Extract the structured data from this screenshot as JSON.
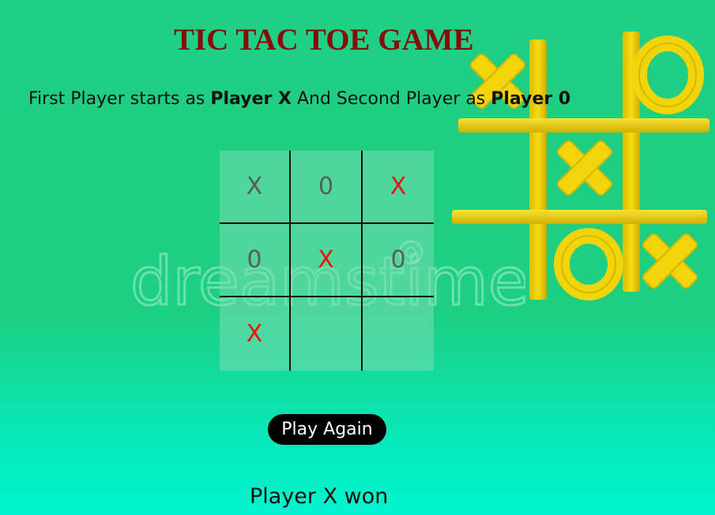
{
  "game": {
    "title": "TIC TAC TOE GAME",
    "intro": {
      "text1": "First Player starts as ",
      "player1": "Player X",
      "text2": " And Second Player as ",
      "player2": "Player 0"
    },
    "board": [
      [
        "X",
        "0",
        "X"
      ],
      [
        "0",
        "X",
        "0"
      ],
      [
        "X",
        "",
        ""
      ]
    ],
    "play_again_label": "Play Again",
    "status": "Player X won",
    "watermark": "dreamstime"
  },
  "colors": {
    "title": "#860c0c",
    "x_mark_red": "#f00e0e",
    "mark_gray": "#5b5b5b",
    "background_top": "#1fcf84",
    "background_bottom": "#00f5d0",
    "button_bg": "#000000",
    "button_text": "#ffffff",
    "art_yellow": "#f2d40a"
  }
}
